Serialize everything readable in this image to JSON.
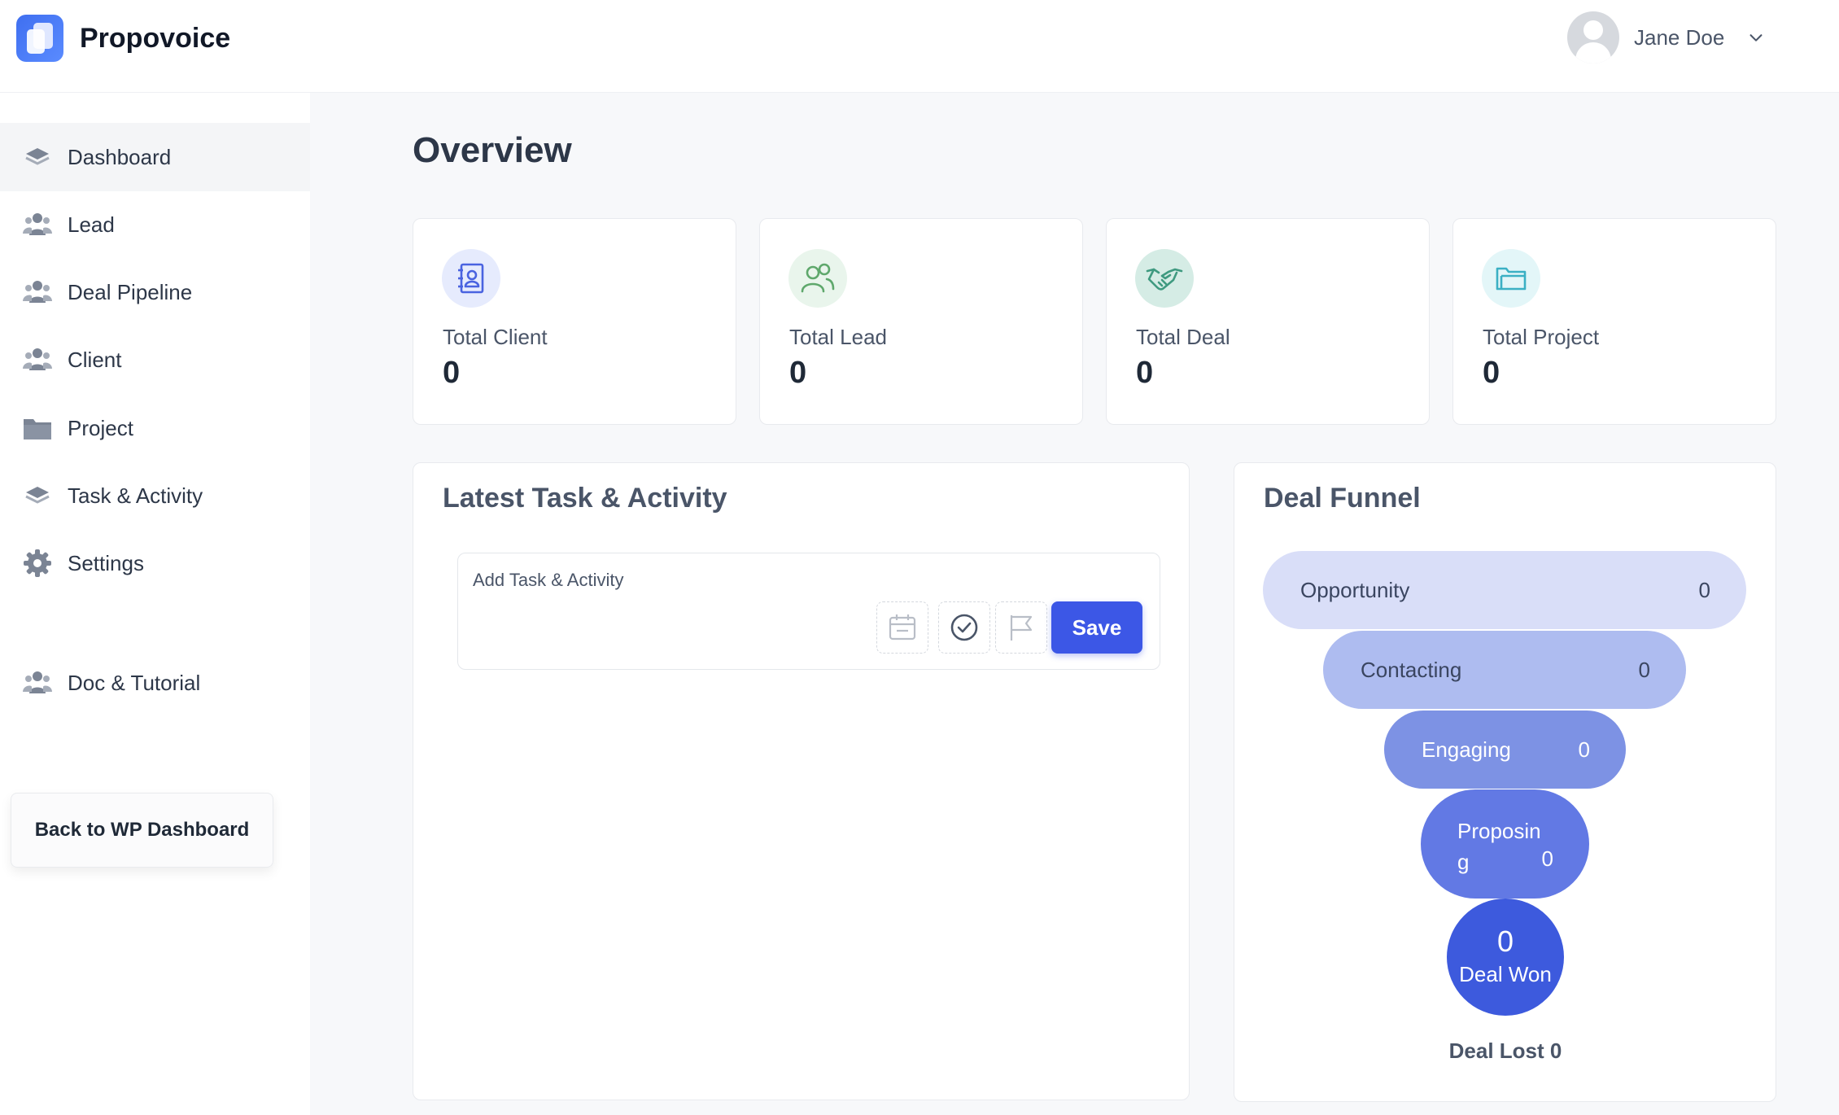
{
  "app": {
    "name": "Propovoice"
  },
  "user": {
    "name": "Jane Doe"
  },
  "sidebar": {
    "items": [
      {
        "label": "Dashboard",
        "icon": "layers-icon"
      },
      {
        "label": "Lead",
        "icon": "users-icon"
      },
      {
        "label": "Deal Pipeline",
        "icon": "users-icon"
      },
      {
        "label": "Client",
        "icon": "users-icon"
      },
      {
        "label": "Project",
        "icon": "folder-icon"
      },
      {
        "label": "Task & Activity",
        "icon": "layers-icon"
      },
      {
        "label": "Settings",
        "icon": "gear-icon"
      },
      {
        "label": "Doc & Tutorial",
        "icon": "users-icon"
      }
    ],
    "back_button": "Back to WP Dashboard"
  },
  "main": {
    "title": "Overview",
    "stats": [
      {
        "label": "Total Client",
        "value": "0",
        "icon": "contact-book-icon"
      },
      {
        "label": "Total Lead",
        "value": "0",
        "icon": "users-icon"
      },
      {
        "label": "Total Deal",
        "value": "0",
        "icon": "handshake-icon"
      },
      {
        "label": "Total Project",
        "value": "0",
        "icon": "folder-icon"
      }
    ],
    "tasks": {
      "title": "Latest Task & Activity",
      "placeholder": "Add Task & Activity",
      "save_label": "Save"
    },
    "funnel": {
      "title": "Deal Funnel",
      "stages": [
        {
          "label": "Opportunity",
          "value": "0"
        },
        {
          "label": "Contacting",
          "value": "0"
        },
        {
          "label": "Engaging",
          "value": "0"
        },
        {
          "label": "Proposing",
          "value": "0"
        }
      ],
      "won": {
        "label": "Deal Won",
        "value": "0"
      },
      "lost": {
        "label": "Deal Lost",
        "value": "0"
      }
    }
  },
  "colors": {
    "accent": "#3c57e6",
    "stage1": "#d9def8",
    "stage2": "#aebcf0",
    "stage3": "#7d92e4",
    "stage4": "#6279e4",
    "won": "#3d5add"
  }
}
